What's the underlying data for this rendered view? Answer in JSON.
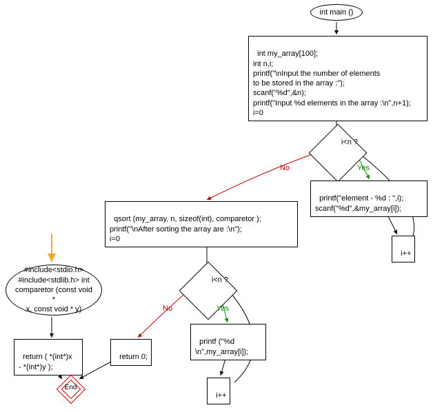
{
  "nodes": {
    "main_ellipse": "int main ()",
    "block1": "int my_array[100];\nint n,i;\nprintf(\"\\nInput the number of elements\nto be stored in the array :\");\nscanf(\"%d\",&n);\nprintf(\"Input %d elements in the array :\\n\",n+1);\ni=0",
    "cond1": "i<n ?",
    "loop1_body": "printf(\"element - %d : \",i);\nscanf(\"%d\",&my_array[i]);",
    "loop1_inc": "i++",
    "block2": "qsort (my_array, n, sizeof(int), comparetor );\nprintf(\"\\nAfter sorting the array are :\\n\");\ni=0",
    "cond2": "i<n ?",
    "loop2_body": "printf (\"%d\n\\n\",my_array[i]);",
    "loop2_inc": "i++",
    "return0": "return 0;",
    "include_ellipse": "#include<stdio.h>\n#include<stdlib.h> int\ncomparetor (const void *\nx, const void * y)",
    "return_cmp": "return ( *(int*)x\n- *(int*)y );",
    "end": "End"
  },
  "labels": {
    "yes1": "Yes",
    "no1": "No",
    "yes2": "Yes",
    "no2": "No"
  }
}
